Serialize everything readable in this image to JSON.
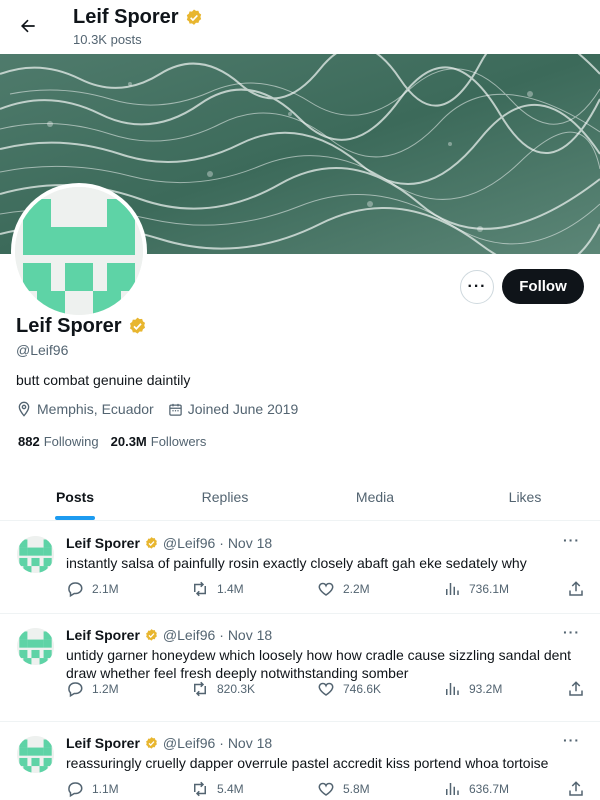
{
  "header": {
    "name": "Leif Sporer",
    "post_count": "10.3K posts"
  },
  "profile": {
    "name": "Leif Sporer",
    "handle": "@Leif96",
    "bio": "butt combat genuine daintily",
    "location": "Memphis, Ecuador",
    "joined": "Joined June 2019",
    "following_count": "882",
    "following_label": "Following",
    "followers_count": "20.3M",
    "followers_label": "Followers",
    "follow_label": "Follow",
    "more_label": "···"
  },
  "tabs": [
    {
      "label": "Posts",
      "active": true
    },
    {
      "label": "Replies",
      "active": false
    },
    {
      "label": "Media",
      "active": false
    },
    {
      "label": "Likes",
      "active": false
    }
  ],
  "posts": [
    {
      "name": "Leif Sporer",
      "handle": "@Leif96",
      "date": "· Nov 18",
      "text": "instantly salsa of painfully rosin exactly closely abaft gah eke sedately why",
      "replies": "2.1M",
      "reposts": "1.4M",
      "likes": "2.2M",
      "views": "736.1M"
    },
    {
      "name": "Leif Sporer",
      "handle": "@Leif96",
      "date": "· Nov 18",
      "text": "untidy garner honeydew which loosely how how cradle cause sizzling sandal dent draw whether feel fresh deeply notwithstanding somber",
      "replies": "1.2M",
      "reposts": "820.3K",
      "likes": "746.6K",
      "views": "93.2M"
    },
    {
      "name": "Leif Sporer",
      "handle": "@Leif96",
      "date": "· Nov 18",
      "text": "reassuringly cruelly dapper overrule pastel accredit kiss portend whoa tortoise",
      "replies": "1.1M",
      "reposts": "5.4M",
      "likes": "5.8M",
      "views": "636.7M"
    }
  ],
  "icons": {
    "back": "arrow-left-icon",
    "verified": "verified-badge-icon",
    "location": "location-pin-icon",
    "calendar": "calendar-icon",
    "reply": "reply-icon",
    "repost": "repost-icon",
    "like": "heart-icon",
    "views": "views-chart-icon",
    "share": "share-icon"
  },
  "colors": {
    "accent": "#1d9bf0",
    "verified": "#e8b62f",
    "avatar_green": "#5ed3a6",
    "text": "#0f1419",
    "muted": "#536471"
  }
}
